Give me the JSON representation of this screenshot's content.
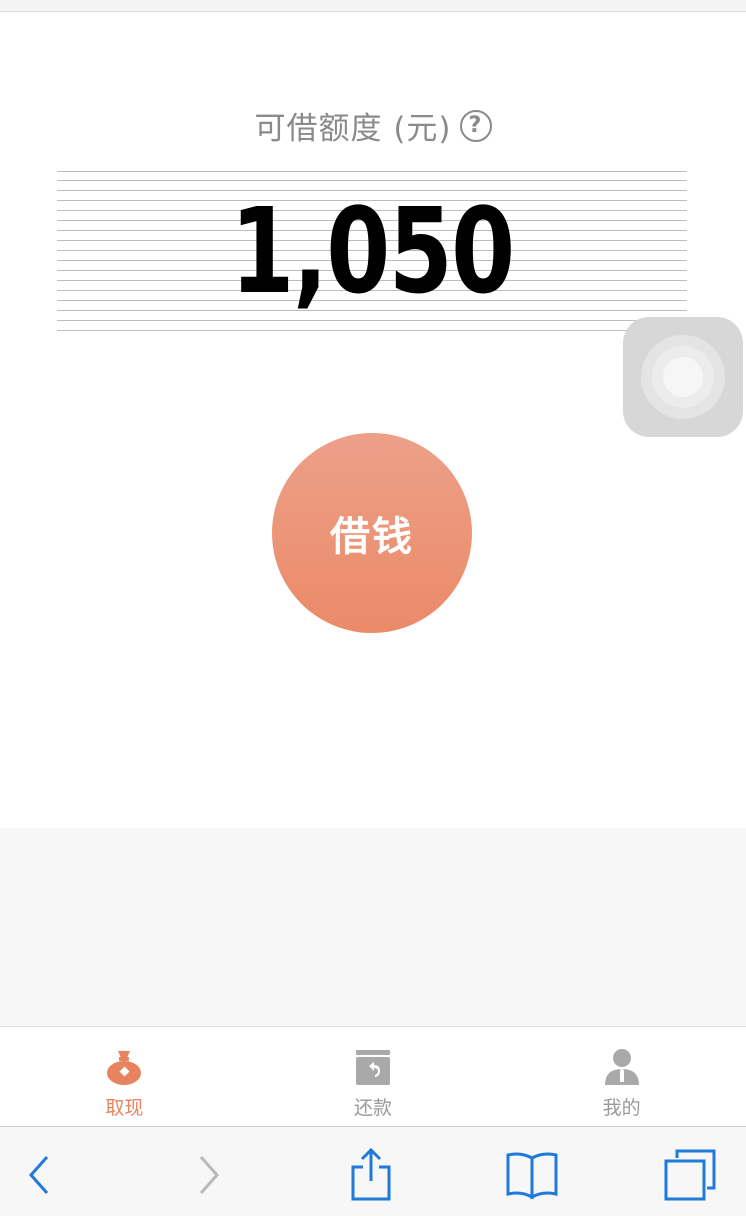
{
  "credit": {
    "title": "可借额度 (元)",
    "help_symbol": "?",
    "amount": "1,050"
  },
  "borrow_button_label": "借钱",
  "tabs": [
    {
      "label": "取现",
      "icon": "money-bag-icon",
      "active": true
    },
    {
      "label": "还款",
      "icon": "repay-box-icon",
      "active": false
    },
    {
      "label": "我的",
      "icon": "user-icon",
      "active": false
    }
  ],
  "colors": {
    "accent": "#e8835f",
    "inactive": "#9a9a9a",
    "ios_blue": "#1f7ad8"
  },
  "browser_toolbar": {
    "icons": [
      "back-arrow-icon",
      "forward-arrow-icon",
      "share-icon",
      "bookmarks-icon",
      "tabs-icon"
    ]
  }
}
